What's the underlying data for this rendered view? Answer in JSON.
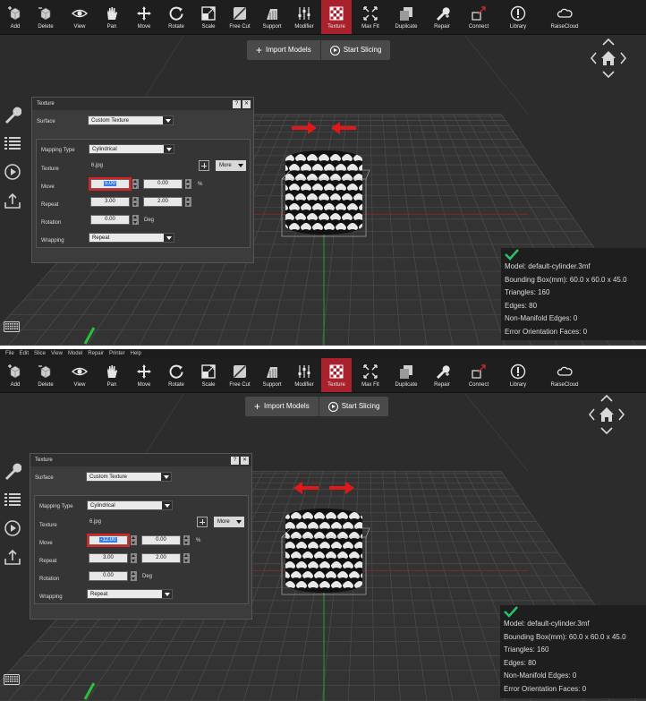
{
  "menu": [
    "File",
    "Edit",
    "Slice",
    "View",
    "Model",
    "Repair",
    "Printer",
    "Help"
  ],
  "toolbar": [
    {
      "label": "Add",
      "icon": "add-cube-icon"
    },
    {
      "label": "Delete",
      "icon": "delete-cube-icon"
    },
    {
      "label": "View",
      "icon": "eye-icon"
    },
    {
      "label": "Pan",
      "icon": "hand-icon"
    },
    {
      "label": "Move",
      "icon": "move-arrows-icon"
    },
    {
      "label": "Rotate",
      "icon": "rotate-icon"
    },
    {
      "label": "Scale",
      "icon": "scale-icon"
    },
    {
      "label": "Free Cut",
      "icon": "cut-icon"
    },
    {
      "label": "Support",
      "icon": "support-icon"
    },
    {
      "label": "Modifier",
      "icon": "sliders-icon"
    },
    {
      "label": "Texture",
      "icon": "texture-icon"
    },
    {
      "label": "Max Fit",
      "icon": "max-fit-icon"
    },
    {
      "label": "Duplicate",
      "icon": "duplicate-icon"
    },
    {
      "label": "Repair",
      "icon": "wrench-icon"
    },
    {
      "label": "Connect",
      "icon": "connect-icon"
    },
    {
      "label": "Library",
      "icon": "library-icon"
    },
    {
      "label": "RaiseCloud",
      "icon": "cloud-icon"
    }
  ],
  "active_tool": "Texture",
  "slice_bar": {
    "import": "Import Models",
    "start": "Start Slicing"
  },
  "dialog": {
    "title": "Texture",
    "help": "?",
    "close": "✕",
    "surface_label": "Surface",
    "surface_value": "Custom Texture",
    "mapping_label": "Mapping Type",
    "mapping_value": "Cylindrical",
    "texture_label": "Texture",
    "texture_file": "6.jpg",
    "more_label": "More",
    "move_label": "Move",
    "move_y": "0.00",
    "move_unit": "%",
    "repeat_label": "Repeat",
    "repeat_x": "3.00",
    "repeat_y": "2.00",
    "rotation_label": "Rotation",
    "rotation_value": "0.00",
    "rotation_unit": "Deg",
    "wrapping_label": "Wrapping",
    "wrapping_value": "Repeat"
  },
  "panels": [
    {
      "move_x": "5.00"
    },
    {
      "move_x": "-12.00"
    }
  ],
  "model_info": {
    "model": "Model: default-cylinder.3mf",
    "bbox": "Bounding Box(mm): 60.0 x 60.0 x 45.0",
    "triangles": "Triangles: 160",
    "edges": "Edges: 80",
    "non_manifold": "Non-Manifold Edges: 0",
    "error_faces": "Error Orientation Faces: 0"
  },
  "colors": {
    "accent": "#a8212d",
    "highlight": "#e02020",
    "check": "#2bbf6a",
    "selection": "#3d7de8"
  }
}
